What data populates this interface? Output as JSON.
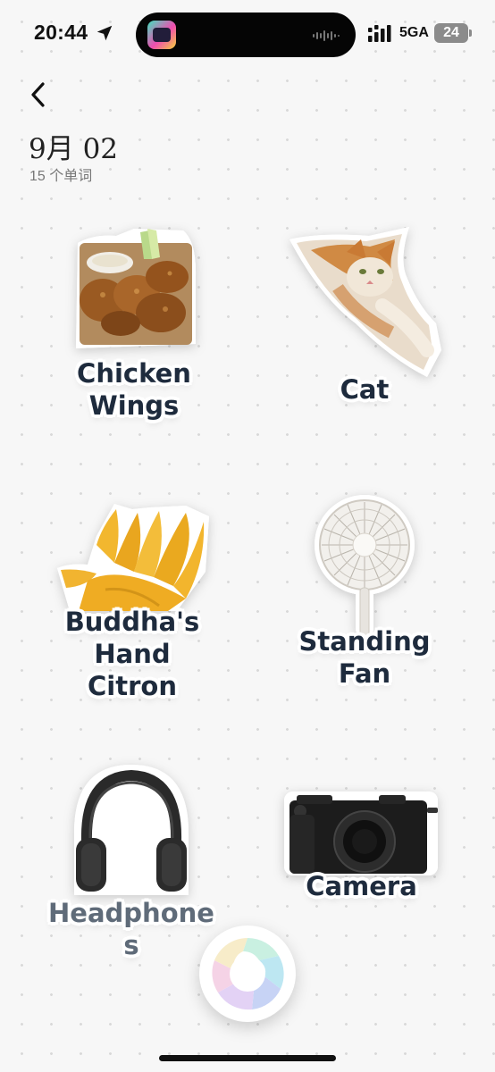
{
  "status_bar": {
    "time": "20:44",
    "network": "5GA",
    "battery": "24",
    "icons": [
      "location-arrow-icon",
      "signal-icon",
      "battery-icon",
      "waveform-icon"
    ]
  },
  "header": {
    "title": "9月 02",
    "subtitle": "15 个单词"
  },
  "stickers": [
    {
      "label": "Chicken\nWings",
      "icon": "chicken-wings-image"
    },
    {
      "label": "Cat",
      "icon": "cat-image"
    },
    {
      "label": "Buddha's\nHand\nCitron",
      "icon": "buddhas-hand-citron-image"
    },
    {
      "label": "Standing\nFan",
      "icon": "standing-fan-image"
    },
    {
      "label": "Headphone\ns",
      "icon": "headphones-image"
    },
    {
      "label": "Camera",
      "icon": "camera-image"
    }
  ],
  "colors": {
    "background": "#f7f7f7",
    "label_text": "#1e2b3d",
    "island": "#050505"
  }
}
